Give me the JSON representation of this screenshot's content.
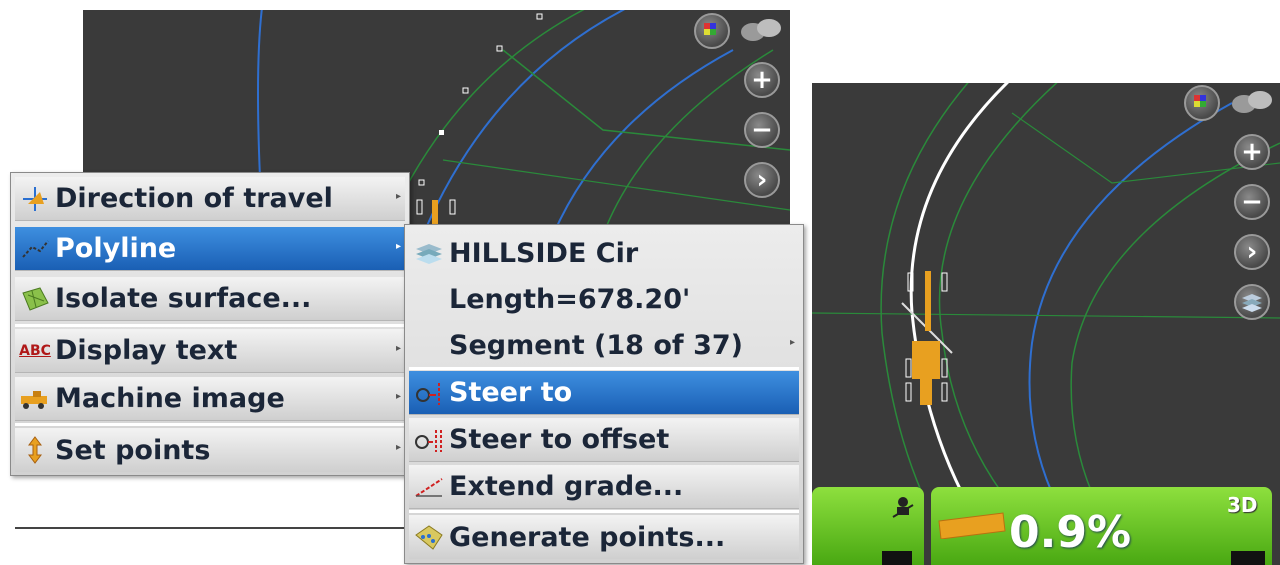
{
  "context_menu": {
    "items": [
      {
        "label": "Direction of travel",
        "icon": "direction-of-travel-icon",
        "submenu": true
      },
      {
        "label": "Polyline",
        "icon": "polyline-icon",
        "submenu": true,
        "selected": true
      },
      {
        "label": "Isolate surface...",
        "icon": "isolate-surface-icon",
        "submenu": false
      },
      {
        "label": "Display text",
        "icon": "abc-text-icon",
        "icon_text": "ABC",
        "submenu": true
      },
      {
        "label": "Machine image",
        "icon": "machine-image-icon",
        "submenu": true
      },
      {
        "label": "Set points",
        "icon": "set-points-icon",
        "submenu": true
      }
    ]
  },
  "polyline_submenu": {
    "name": "HILLSIDE Cir",
    "length": "Length=678.20'",
    "segment": "Segment (18 of 37)",
    "items": [
      {
        "label": "Steer to",
        "icon": "steer-to-icon",
        "selected": true
      },
      {
        "label": "Steer to offset",
        "icon": "steer-to-offset-icon"
      },
      {
        "label": "Extend grade...",
        "icon": "extend-grade-icon"
      },
      {
        "label": "Generate points...",
        "icon": "generate-points-icon"
      }
    ]
  },
  "status_bar": {
    "grade_value": "0.9%",
    "mode_label": "3D"
  },
  "colors": {
    "map_background": "#3a3a3a",
    "menu_selected": "#1a5fb4",
    "status_green": "#5cbc1e",
    "machine_orange": "#e8a020",
    "road_line_blue": "#2f6fd0",
    "grid_line_green": "#2a8a3a"
  }
}
